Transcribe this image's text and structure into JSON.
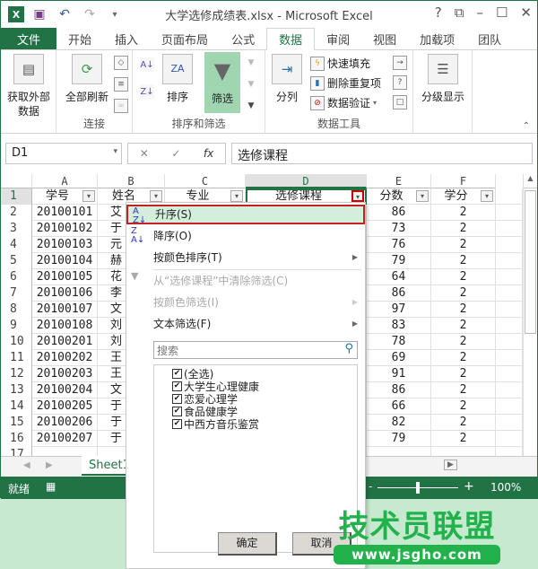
{
  "window": {
    "title": "大学选修成绩表.xlsx - Microsoft Excel",
    "help": "?",
    "restore": "⧉",
    "minimize": "–",
    "maximize": "☐",
    "close": "✕"
  },
  "tabs": [
    "文件",
    "开始",
    "插入",
    "页面布局",
    "公式",
    "数据",
    "审阅",
    "视图",
    "加载项",
    "团队"
  ],
  "active_tab": "数据",
  "ribbon": {
    "get_external": "获取外部数据",
    "refresh_all": "全部刷新",
    "group_connections": "连接",
    "sort": "排序",
    "filter": "筛选",
    "group_sort_filter": "排序和筛选",
    "text_to_columns": "分列",
    "flash_fill": "快速填充",
    "remove_duplicates": "删除重复项",
    "data_validation": "数据验证",
    "group_data_tools": "数据工具",
    "outline": "分级显示"
  },
  "formula_bar": {
    "name_box": "D1",
    "fx": "fx",
    "cancel": "✕",
    "enter": "✓",
    "value": "选修课程"
  },
  "columns": [
    "A",
    "B",
    "C",
    "D",
    "E",
    "F"
  ],
  "headers": [
    "学号",
    "姓名",
    "专业",
    "选修课程",
    "分数",
    "学分"
  ],
  "rows": [
    [
      "20100101",
      "艾",
      "",
      "",
      "86",
      "2"
    ],
    [
      "20100102",
      "于",
      "",
      "",
      "73",
      "2"
    ],
    [
      "20100103",
      "元",
      "",
      "",
      "76",
      "2"
    ],
    [
      "20100104",
      "赫",
      "",
      "",
      "79",
      "2"
    ],
    [
      "20100105",
      "花",
      "",
      "",
      "64",
      "2"
    ],
    [
      "20100106",
      "李",
      "",
      "",
      "86",
      "2"
    ],
    [
      "20100107",
      "文",
      "",
      "",
      "97",
      "2"
    ],
    [
      "20100108",
      "刘",
      "",
      "",
      "83",
      "2"
    ],
    [
      "20100201",
      "刘",
      "",
      "",
      "78",
      "2"
    ],
    [
      "20100202",
      "王",
      "",
      "",
      "69",
      "2"
    ],
    [
      "20100203",
      "王",
      "",
      "",
      "91",
      "2"
    ],
    [
      "20100204",
      "文",
      "",
      "",
      "86",
      "2"
    ],
    [
      "20100205",
      "于",
      "",
      "",
      "66",
      "2"
    ],
    [
      "20100206",
      "于",
      "",
      "",
      "82",
      "2"
    ],
    [
      "20100207",
      "于",
      "",
      "",
      "79",
      "2"
    ]
  ],
  "sheet_tab": "Sheet1",
  "status": {
    "ready": "就绪",
    "zoom": "100%",
    "zoom_level_percent": 100
  },
  "filter_menu": {
    "sort_asc": "升序(S)",
    "sort_desc": "降序(O)",
    "sort_by_color": "按颜色排序(T)",
    "clear_filter": "从“选修课程”中清除筛选(C)",
    "filter_by_color": "按颜色筛选(I)",
    "text_filters": "文本筛选(F)",
    "search_placeholder": "搜索",
    "items": [
      {
        "label": "(全选)",
        "checked": true
      },
      {
        "label": "大学生心理健康",
        "checked": true
      },
      {
        "label": "恋爱心理学",
        "checked": true
      },
      {
        "label": "食品健康学",
        "checked": true
      },
      {
        "label": "中西方音乐鉴赏",
        "checked": true
      }
    ],
    "ok": "确定",
    "cancel": "取消"
  },
  "watermark": {
    "name": "技术员联盟",
    "url": "www.jsgho.com"
  },
  "colors": {
    "excel_green": "#217346",
    "highlight": "#d3efdb",
    "selection_border": "#c42121"
  }
}
